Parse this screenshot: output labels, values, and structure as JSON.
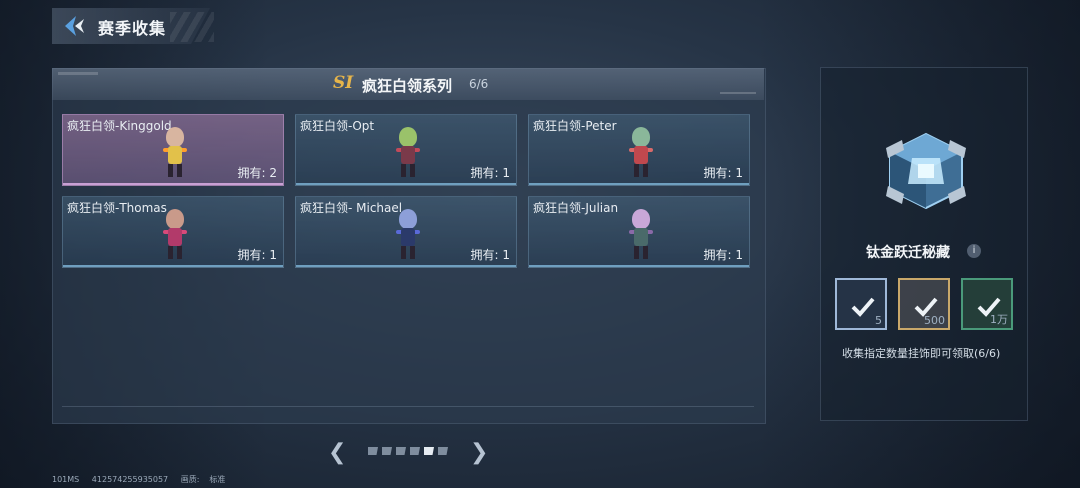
{
  "header": {
    "title": "赛季收集",
    "back_icon": "back-arrow-icon"
  },
  "collection": {
    "season_badge": "SI",
    "series_title": "疯狂白领系列",
    "progress": "6/6",
    "cards": [
      {
        "name": "疯狂白领-Kinggold",
        "owned": "拥有: 2",
        "selected": true,
        "head": "#d8b5a0",
        "body": "#e2c14a",
        "arm": "#ff9e2c"
      },
      {
        "name": "疯狂白领-Opt",
        "owned": "拥有: 1",
        "selected": false,
        "head": "#9ac26a",
        "body": "#7a3a4a",
        "arm": "#c24a5a"
      },
      {
        "name": "疯狂白领-Peter",
        "owned": "拥有: 1",
        "selected": false,
        "head": "#8ab79a",
        "body": "#c0484e",
        "arm": "#d86a6a"
      },
      {
        "name": "疯狂白领-Thomas",
        "owned": "拥有: 1",
        "selected": false,
        "head": "#c99a8a",
        "body": "#b23a6a",
        "arm": "#d84a7a"
      },
      {
        "name": "疯狂白领- Michael",
        "owned": "拥有: 1",
        "selected": false,
        "head": "#8d9fd8",
        "body": "#2b3a6a",
        "arm": "#5a6ad8"
      },
      {
        "name": "疯狂白领-Julian",
        "owned": "拥有: 1",
        "selected": false,
        "head": "#c9a7d8",
        "body": "#4a6a6a",
        "arm": "#8a6aa8"
      }
    ]
  },
  "pager": {
    "pages": 6,
    "active_index": 4,
    "prev_icon": "chevron-left-icon",
    "next_icon": "chevron-right-icon"
  },
  "reward": {
    "title": "钛金跃迁秘藏",
    "info_symbol": "i",
    "tiers": [
      {
        "amount": "5",
        "icon": "check-icon",
        "border": "#9fb8d8"
      },
      {
        "amount": "500",
        "icon": "check-icon",
        "border": "#c9a86a"
      },
      {
        "amount": "1万",
        "icon": "check-icon",
        "border": "#4a9a7a"
      }
    ],
    "description": "收集指定数量挂饰即可领取(6/6)"
  },
  "footer": {
    "ping": "101MS",
    "id": "412574255935057",
    "quality_label": "画质:",
    "quality_value": "标准"
  }
}
